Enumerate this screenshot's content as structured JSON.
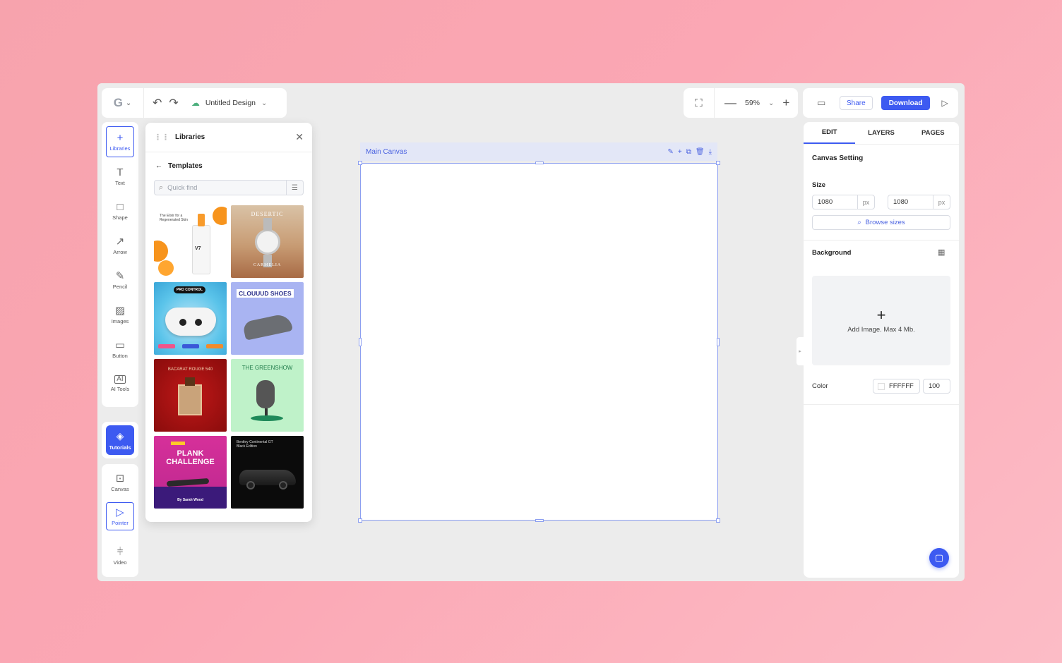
{
  "topbar": {
    "logo_icon": "brand-g-logo",
    "undo_icon": "undo-icon",
    "redo_icon": "redo-icon",
    "design_title": "Untitled Design",
    "fit_icon": "fit-screen-icon",
    "zoom_level": "59%",
    "share_label": "Share",
    "download_label": "Download"
  },
  "tools": [
    {
      "label": "Libraries",
      "icon": "plus-icon",
      "active": true
    },
    {
      "label": "Text",
      "icon": "text-icon"
    },
    {
      "label": "Shape",
      "icon": "shape-icon"
    },
    {
      "label": "Arrow",
      "icon": "arrow-icon"
    },
    {
      "label": "Pencil",
      "icon": "pencil-icon"
    },
    {
      "label": "Images",
      "icon": "image-icon"
    },
    {
      "label": "Button",
      "icon": "button-icon"
    },
    {
      "label": "AI Tools",
      "icon": "ai-icon"
    }
  ],
  "tutorials": {
    "label": "Tutorials",
    "icon": "layers-icon"
  },
  "bottom_tools": [
    {
      "label": "Canvas",
      "icon": "canvas-icon"
    },
    {
      "label": "Pointer",
      "icon": "pointer-icon",
      "active": true
    },
    {
      "label": "Video",
      "icon": "video-icon"
    }
  ],
  "library": {
    "title": "Libraries",
    "section": "Templates",
    "search_placeholder": "Quick find",
    "templates": [
      {
        "name": "skincare",
        "caption": "The Elixir for a Regenerated Skin",
        "sub": "V7"
      },
      {
        "name": "watch",
        "caption": "DESERTIC",
        "sub": "CARMELIA"
      },
      {
        "name": "gamepad",
        "caption": "PRO CONTROL",
        "sub": ""
      },
      {
        "name": "shoes",
        "caption": "CLOUUUD SHOES",
        "sub": ""
      },
      {
        "name": "perfume",
        "caption": "BACARAT ROUGE 540",
        "sub": ""
      },
      {
        "name": "podcast",
        "caption": "THE GREENSHOW",
        "sub": ""
      },
      {
        "name": "plank",
        "caption": "PLANK CHALLENGE",
        "sub": "By Sarah Wood"
      },
      {
        "name": "car",
        "caption": "Bentley Continental GT Black Edition",
        "sub": ""
      }
    ]
  },
  "canvas": {
    "label": "Main Canvas"
  },
  "right_panel": {
    "tabs": [
      "EDIT",
      "LAYERS",
      "PAGES"
    ],
    "canvas_setting": "Canvas Setting",
    "size_label": "Size",
    "width": "1080",
    "height": "1080",
    "unit": "px",
    "browse_sizes": "Browse sizes",
    "background_label": "Background",
    "add_image": "Add Image. Max 4 Mb.",
    "color_label": "Color",
    "color_hex": "FFFFFF",
    "opacity": "100"
  },
  "colors": {
    "accent": "#3d5af1",
    "background": "#f7a3ad"
  }
}
